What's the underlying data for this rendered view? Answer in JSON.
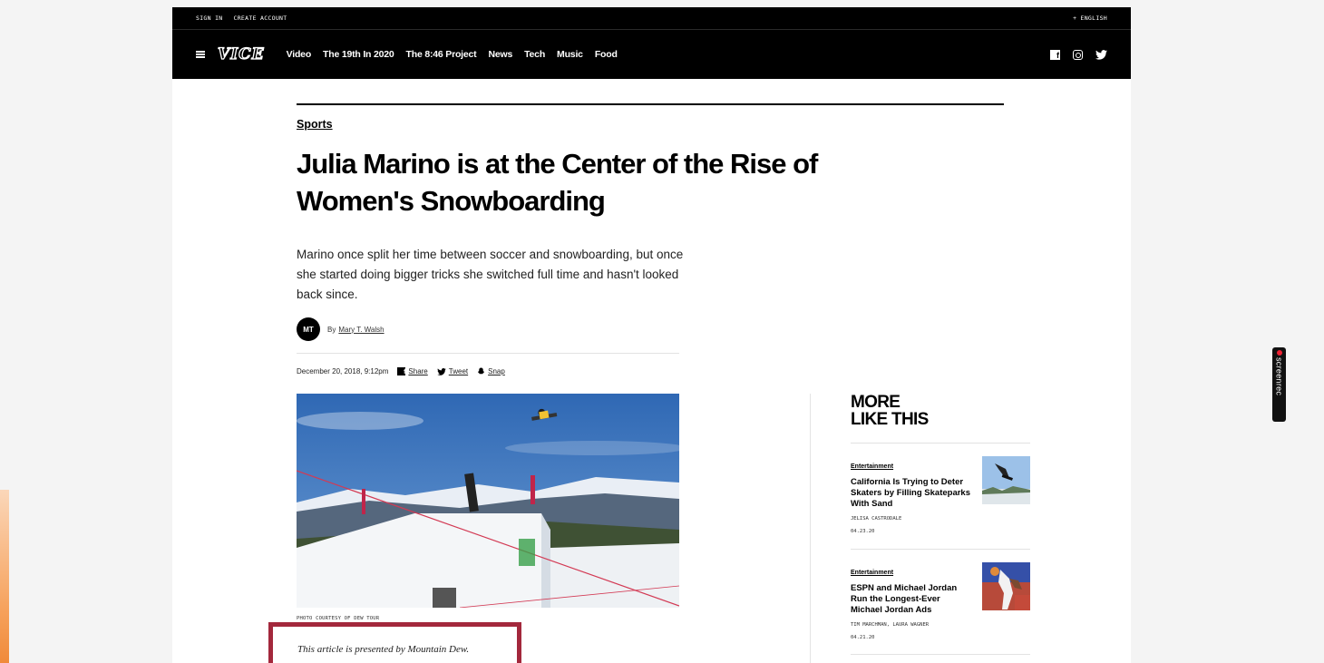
{
  "top_bar": {
    "sign_in": "SIGN IN",
    "create_account": "CREATE ACCOUNT",
    "language": "+ ENGLISH",
    "logo": "VICE",
    "nav_items": [
      "Video",
      "The 19th In 2020",
      "The 8:46 Project",
      "News",
      "Tech",
      "Music",
      "Food"
    ]
  },
  "article": {
    "section": "Sports",
    "headline_line1": "Julia Marino is at the Center of the Rise of",
    "headline_line2": "Women's Snowboarding",
    "dek": "Marino once split her time between soccer and snowboarding, but once she started doing bigger tricks she switched full time and hasn't looked back since.",
    "author_initials": "MT",
    "by_prefix": "By",
    "author": "Mary T. Walsh",
    "date": "December 20, 2018, 9:12pm",
    "share_facebook": "Share",
    "share_twitter": "Tweet",
    "share_snap": "Snap",
    "photo_credit": "PHOTO COURTESY OF DEW TOUR",
    "sponsor_note": "This article is presented by Mountain Dew."
  },
  "sidebar": {
    "title_line1": "MORE",
    "title_line2": "LIKE THIS",
    "items": [
      {
        "category": "Entertainment",
        "title": "California Is Trying to Deter Skaters by Filling Skateparks With Sand",
        "author": "JELISA CASTRODALE",
        "date": "04.23.20"
      },
      {
        "category": "Entertainment",
        "title": "ESPN and Michael Jordan Run the Longest-Ever Michael Jordan Ads",
        "author": "TIM MARCHMAN, LAURA WAGNER",
        "date": "04.21.20"
      }
    ]
  },
  "overlay": {
    "screenrec_label": "screenrec"
  },
  "colors": {
    "nav_background": "#000000",
    "sponsor_frame": "#a3283c",
    "page_background": "#f4f4f4"
  }
}
